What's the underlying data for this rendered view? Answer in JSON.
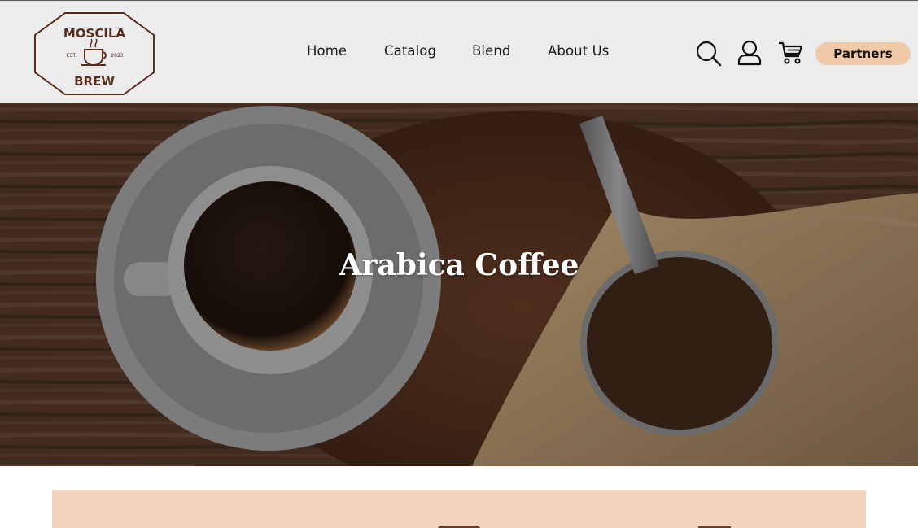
{
  "brand": {
    "name_top": "MOSCILA",
    "name_bottom": "BREW",
    "est": "EST.",
    "year": "2023",
    "color": "#5a2d1e"
  },
  "nav": {
    "items": [
      {
        "label": "Home"
      },
      {
        "label": "Catalog"
      },
      {
        "label": "Blend"
      },
      {
        "label": "About Us"
      }
    ]
  },
  "actions": {
    "icons": [
      "search-icon",
      "user-icon",
      "cart-icon"
    ],
    "partners_label": "Partners",
    "partners_color": "#f0c9a8"
  },
  "hero": {
    "title": "Arabica Coffee"
  },
  "panel": {
    "color": "#f3d5bd"
  }
}
